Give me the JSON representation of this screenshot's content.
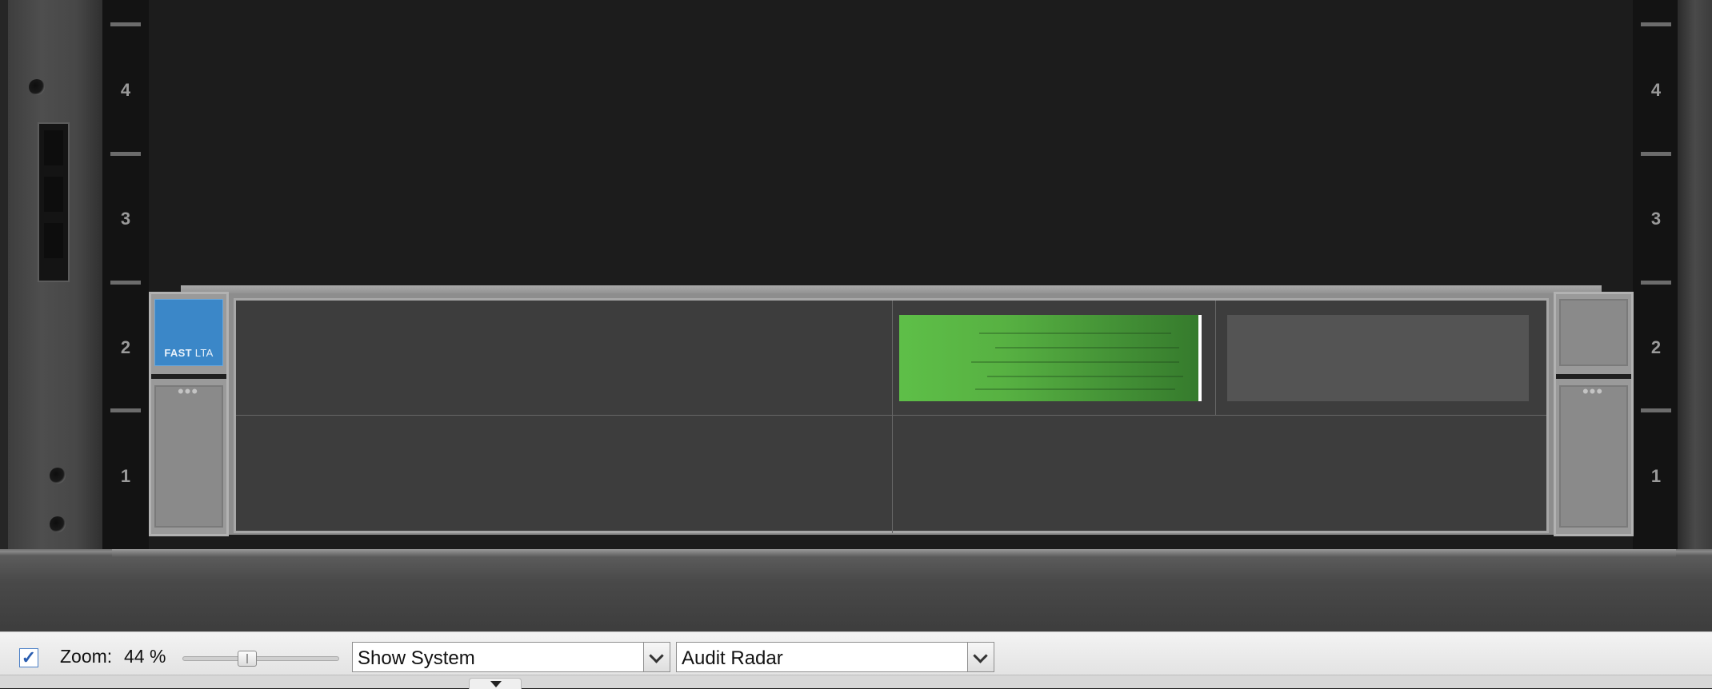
{
  "rack": {
    "units_left": [
      {
        "label": "4"
      },
      {
        "label": "3"
      },
      {
        "label": "2"
      },
      {
        "label": "1"
      }
    ],
    "units_right": [
      {
        "label": "4"
      },
      {
        "label": "3"
      },
      {
        "label": "2"
      },
      {
        "label": "1"
      }
    ]
  },
  "server": {
    "brand_bold": "FAST",
    "brand_light": "LTA",
    "ear_dots": "•••",
    "status_display_color": "#57b142",
    "brand_color": "#3b87c8"
  },
  "toolbar": {
    "show_checked": true,
    "checkbox_mark": "✓",
    "zoom_label": "Zoom:",
    "zoom_value": "44 %",
    "zoom_level_percent": 44,
    "view_select": "Show System",
    "device_select": "Audit Radar"
  },
  "icons": {
    "checkbox": "checkbox-checked-icon",
    "dropdown_arrow": "chevron-down-icon",
    "panel_toggle": "triangle-down-icon"
  }
}
